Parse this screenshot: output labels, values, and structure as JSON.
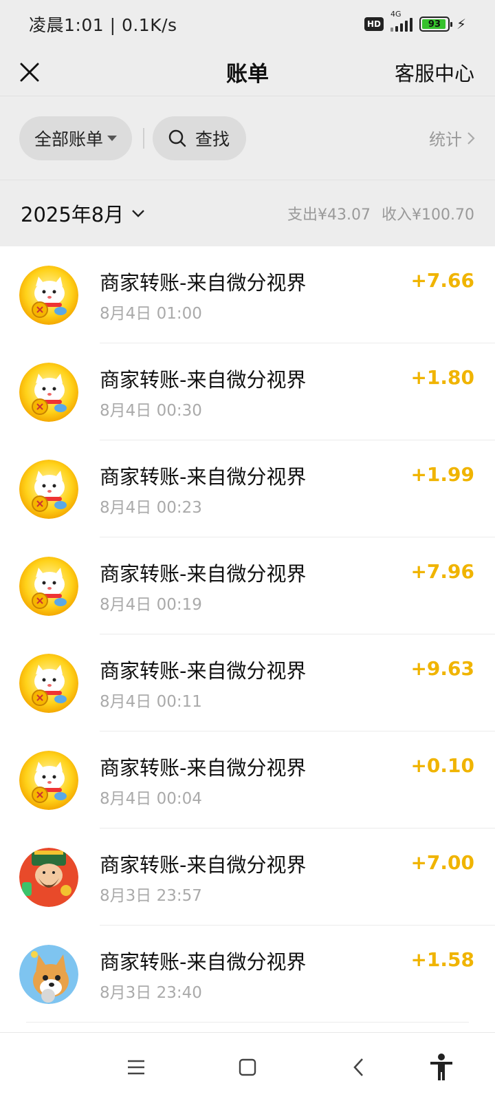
{
  "status_bar": {
    "time_speed": "凌晨1:01 | 0.1K/s",
    "hd": "HD",
    "network": "4G",
    "battery": "93"
  },
  "nav": {
    "title": "账单",
    "service": "客服中心"
  },
  "filters": {
    "all_bills": "全部账单",
    "search": "查找",
    "stats": "统计"
  },
  "month": {
    "label": "2025年8月",
    "expense": "支出¥43.07",
    "income": "收入¥100.70"
  },
  "transactions": [
    {
      "title": "商家转账-来自微分视界",
      "time": "8月4日 01:00",
      "amount": "+7.66",
      "avatar": "lucky-cat"
    },
    {
      "title": "商家转账-来自微分视界",
      "time": "8月4日 00:30",
      "amount": "+1.80",
      "avatar": "lucky-cat"
    },
    {
      "title": "商家转账-来自微分视界",
      "time": "8月4日 00:23",
      "amount": "+1.99",
      "avatar": "lucky-cat"
    },
    {
      "title": "商家转账-来自微分视界",
      "time": "8月4日 00:19",
      "amount": "+7.96",
      "avatar": "lucky-cat"
    },
    {
      "title": "商家转账-来自微分视界",
      "time": "8月4日 00:11",
      "amount": "+9.63",
      "avatar": "lucky-cat"
    },
    {
      "title": "商家转账-来自微分视界",
      "time": "8月4日 00:04",
      "amount": "+0.10",
      "avatar": "lucky-cat"
    },
    {
      "title": "商家转账-来自微分视界",
      "time": "8月3日 23:57",
      "amount": "+7.00",
      "avatar": "fortune-god"
    },
    {
      "title": "商家转账-来自微分视界",
      "time": "8月3日 23:40",
      "amount": "+1.58",
      "avatar": "shiba-dog"
    }
  ],
  "colors": {
    "amount": "#f0b400",
    "background": "#ededed"
  }
}
